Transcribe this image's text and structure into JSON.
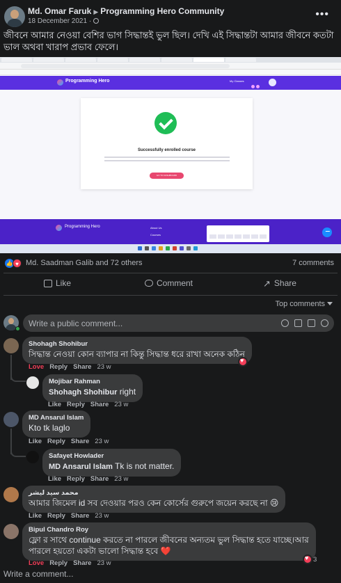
{
  "post": {
    "author": "Md. Omar Faruk",
    "group": "Programming Hero Community",
    "date": "18 December 2021",
    "separator": "·",
    "text": "জীবনে আমার নেওয়া বেশির ভাগ সিদ্ধান্তই ভুল ছিল। দেখি এই সিদ্ধান্তটা আমার জীবনে কতটা ভাল অথবা খারাপ প্রভাব ফেলে।",
    "icons": [
      "avatar",
      "globe-icon",
      "more-options-icon"
    ]
  },
  "screenshot": {
    "brand": "Programming Hero",
    "nav_item": "My Classes",
    "card_title": "Successfully enrolled course",
    "button": "GO TO DASHBOARD",
    "footer_brand": "Programming Hero",
    "footer_links": [
      "About Us",
      "Courses"
    ]
  },
  "reactions": {
    "names": "Md. Saadman Galib and 72 others",
    "comments_count": "7 comments",
    "icons": [
      "like-reaction-icon",
      "love-reaction-icon"
    ]
  },
  "actions": {
    "like": "Like",
    "comment": "Comment",
    "share": "Share"
  },
  "sort": {
    "label": "Top comments"
  },
  "composer": {
    "placeholder": "Write a public comment...",
    "icons": [
      "emoji-icon",
      "camera-icon",
      "gif-icon",
      "sticker-icon"
    ]
  },
  "comments": [
    {
      "name": "Shohagh Shohibur",
      "text": "সিদ্ধান্ত নেওয়া কোন ব্যাপার না কিন্তু সিদ্ধান্ত ধরে রাখা অনেক কঠিন",
      "actions": {
        "love": "Love",
        "reply": "Reply",
        "share": "Share",
        "age": "23 w"
      },
      "reaction_count": "",
      "reply": {
        "name": "Mojibar Rahman",
        "tag": "Shohagh Shohibur",
        "text": "right",
        "actions": {
          "like": "Like",
          "reply": "Reply",
          "share": "Share",
          "age": "23 w"
        }
      }
    },
    {
      "name": "MD Ansarul Islam",
      "text": "Kto tk laglo",
      "actions": {
        "like": "Like",
        "reply": "Reply",
        "share": "Share",
        "age": "23 w"
      },
      "reply": {
        "name": "Safayet Howlader",
        "tag": "MD Ansarul Islam",
        "text": "Tk is not matter.",
        "actions": {
          "like": "Like",
          "reply": "Reply",
          "share": "Share",
          "age": "23 w"
        }
      }
    },
    {
      "name": "محمد سيد ليشر",
      "text": "আমার জিমেল id সব দেওয়ার পরও কেন কোর্সের গুরুপে জয়েন করছে না 😢",
      "actions": {
        "like": "Like",
        "reply": "Reply",
        "share": "Share",
        "age": "23 w"
      }
    },
    {
      "name": "Bipul Chandro Roy",
      "text_line1": "ফ্লো র সাথে continue করতে না পারলে জীবনের অন্যতম ভুল সিদ্ধান্ত হতে যাচ্ছে।আর",
      "text_line2": "পারলে হয়তো একটা ভালো সিদ্ধান্ত হবে ❤️",
      "actions": {
        "love": "Love",
        "reply": "Reply",
        "share": "Share",
        "age": "23 w"
      },
      "reaction_count": "3"
    }
  ],
  "footer": {
    "write_comment": "Write a comment..."
  },
  "colors": {
    "background": "#18191a",
    "bubble": "#3a3b3c",
    "love": "#f33e58",
    "like": "#1877f2",
    "ph_purple": "#5a2fe0",
    "success_green": "#1fbd56"
  }
}
